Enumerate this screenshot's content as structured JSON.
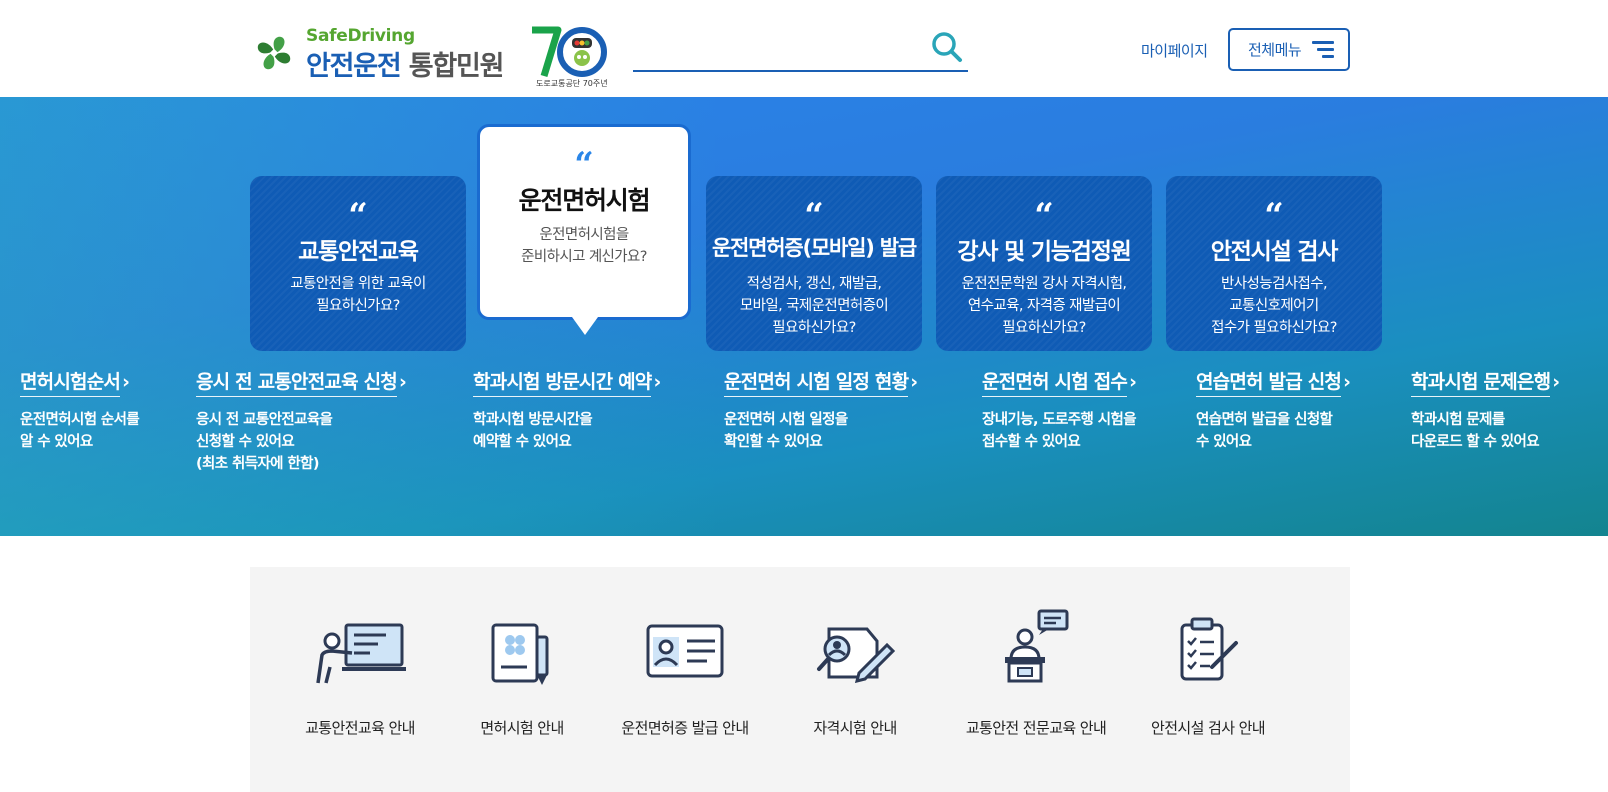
{
  "logo": {
    "en": "SafeDriving",
    "ko_main": "안전운전",
    "ko_sub": "통합민원",
    "anniv_caption": "도로교통공단 70주년"
  },
  "search": {
    "placeholder": ""
  },
  "header": {
    "mypage": "마이페이지",
    "allmenu": "전체메뉴"
  },
  "cards": [
    {
      "title": "교통안전교육",
      "desc": "교통안전을 위한 교육이\n필요하신가요?"
    },
    {
      "title": "운전면허시험",
      "desc": "운전면허시험을\n준비하시고 계신가요?"
    },
    {
      "title": "운전면허증(모바일) 발급",
      "desc": "적성검사, 갱신, 재발급,\n모바일, 국제운전면허증이\n필요하신가요?"
    },
    {
      "title": "강사 및 기능검정원",
      "desc": "운전전문학원 강사 자격시험,\n연수교육, 자격증 재발급이\n필요하신가요?"
    },
    {
      "title": "안전시설 검사",
      "desc": "반사성능검사접수,\n교통신호제어기\n접수가 필요하신가요?"
    }
  ],
  "quick_links": [
    {
      "title": "면허시험순서",
      "desc": "운전면허시험 순서를\n알 수 있어요"
    },
    {
      "title": "응시 전 교통안전교육 신청",
      "desc": "응시 전 교통안전교육을\n신청할 수 있어요\n(최초 취득자에 한함)"
    },
    {
      "title": "학과시험 방문시간 예약",
      "desc": "학과시험 방문시간을\n예약할 수 있어요"
    },
    {
      "title": "운전면허 시험 일정 현황",
      "desc": "운전면허 시험 일정을\n확인할 수 있어요"
    },
    {
      "title": "운전면허 시험 접수",
      "desc": "장내기능, 도로주행 시험을\n접수할 수 있어요"
    },
    {
      "title": "연습면허 발급 신청",
      "desc": "연습면허 발급을 신청할\n수 있어요"
    },
    {
      "title": "학과시험 문제은행",
      "desc": "학과시험 문제를\n다운로드 할 수 있어요"
    }
  ],
  "guides": [
    {
      "label": "교통안전교육 안내",
      "icon": "teacher-board-icon"
    },
    {
      "label": "면허시험 안내",
      "icon": "document-pen-icon"
    },
    {
      "label": "운전면허증 발급 안내",
      "icon": "id-card-icon"
    },
    {
      "label": "자격시험 안내",
      "icon": "magnifier-pen-icon"
    },
    {
      "label": "교통안전 전문교육 안내",
      "icon": "lecturer-podium-icon"
    },
    {
      "label": "안전시설 검사 안내",
      "icon": "clipboard-check-icon"
    }
  ],
  "colors": {
    "brand_blue": "#1a5fb4",
    "brand_green": "#55a630",
    "card_bg": "#0f5bb5",
    "icon_navy": "#2d3a55",
    "icon_light_blue": "#cfe4f7"
  }
}
